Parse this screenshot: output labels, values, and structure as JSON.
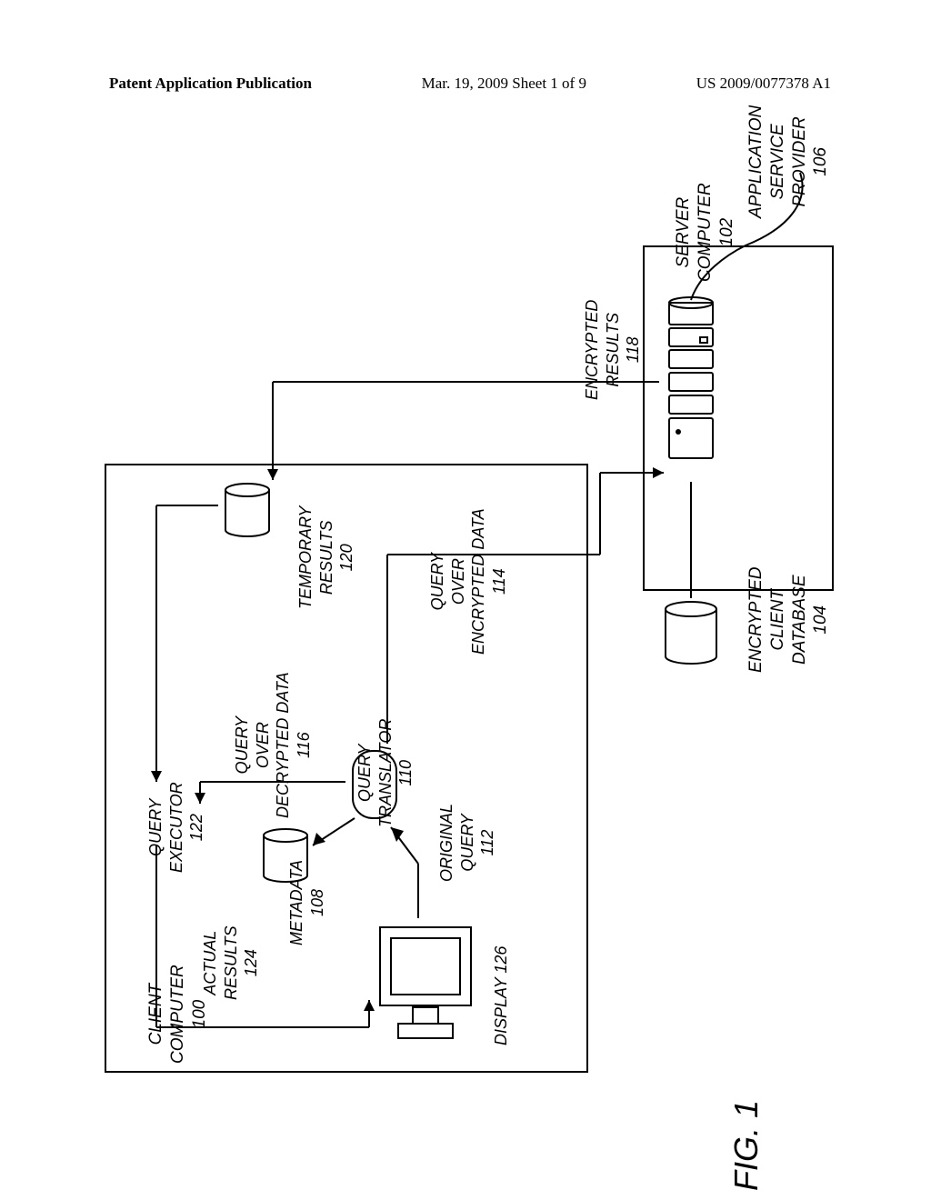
{
  "header": {
    "left": "Patent Application Publication",
    "middle": "Mar. 19, 2009 Sheet 1 of 9",
    "right": "US 2009/0077378 A1"
  },
  "labels": {
    "client_computer": "CLIENT\nCOMPUTER\n100",
    "server_computer": "SERVER\nCOMPUTER\n102",
    "asp": "APPLICATION\nSERVICE\nPROVIDER\n106",
    "encrypted_client_db": "ENCRYPTED\nCLIENT\nDATABASE\n104",
    "encrypted_results": "ENCRYPTED\nRESULTS\n118",
    "query_over_encrypted": "QUERY\nOVER\nENCRYPTED DATA\n114",
    "temporary_results": "TEMPORARY\nRESULTS\n120",
    "original_query": "ORIGINAL\nQUERY\n112",
    "query_translator": "QUERY\nTRANSLATOR\n110",
    "query_over_decrypted": "QUERY\nOVER\nDECRYPTED DATA\n116",
    "metadata": "METADATA\n108",
    "query_executor": "QUERY\nEXECUTOR\n122",
    "actual_results": "ACTUAL\nRESULTS\n124",
    "display": "DISPLAY 126",
    "fig": "FIG. 1"
  }
}
